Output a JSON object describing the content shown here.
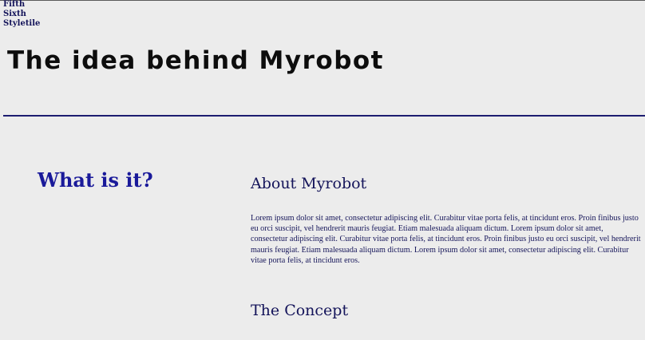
{
  "nav": {
    "items": [
      "Fifth",
      "Sixth",
      "Styletile"
    ]
  },
  "header": {
    "title": "The idea behind Myrobot"
  },
  "sidebar": {
    "heading": "What is it?"
  },
  "main": {
    "sections": [
      {
        "heading": "About Myrobot",
        "body": "Lorem ipsum dolor sit amet, consectetur adipiscing elit. Curabitur vitae porta felis, at tincidunt eros. Proin finibus justo eu orci suscipit, vel hendrerit mauris feugiat. Etiam malesuada aliquam dictum. Lorem ipsum dolor sit amet, consectetur adipiscing elit. Curabitur vitae porta felis, at tincidunt eros. Proin finibus justo eu orci suscipit, vel hendrerit mauris feugiat. Etiam malesuada aliquam dictum. Lorem ipsum dolor sit amet, consectetur adipiscing elit. Curabitur vitae porta felis, at tincidunt eros."
      },
      {
        "heading": "The Concept"
      }
    ]
  },
  "colors": {
    "background": "#ececec",
    "divider": "#1c1c70",
    "side_heading": "#1a1a9a",
    "text": "#14145a"
  }
}
